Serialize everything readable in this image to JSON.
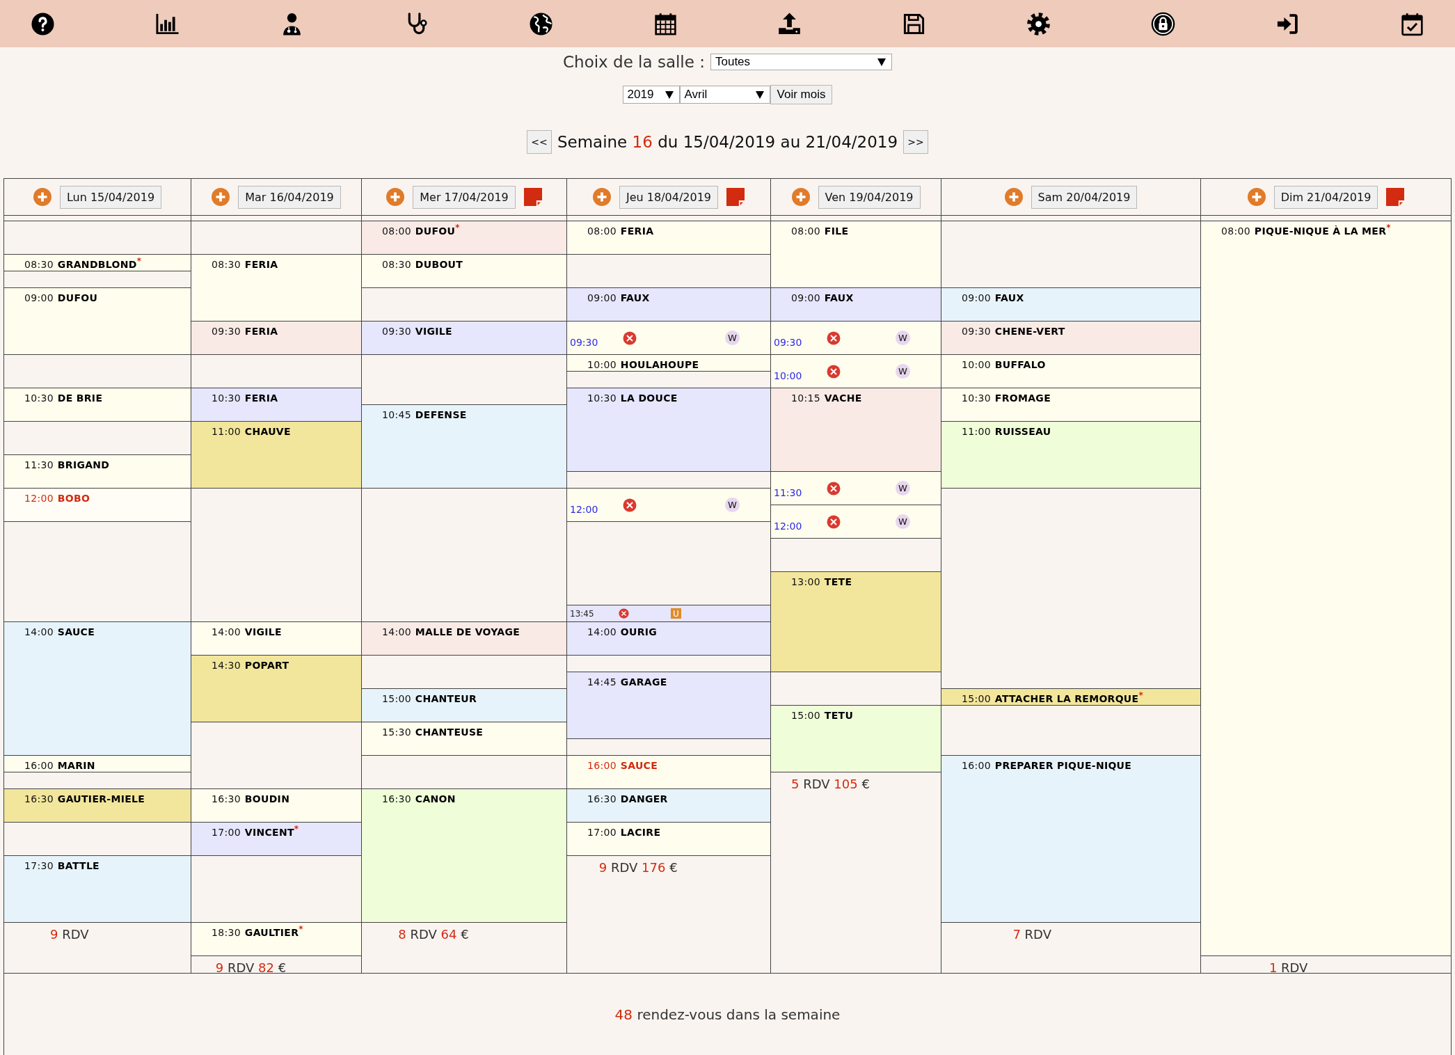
{
  "toolbar": [
    {
      "kind": "help"
    },
    {
      "kind": "chart"
    },
    {
      "kind": "doctor"
    },
    {
      "kind": "stethoscope"
    },
    {
      "kind": "globe"
    },
    {
      "kind": "calendar"
    },
    {
      "kind": "upload"
    },
    {
      "kind": "save"
    },
    {
      "kind": "settings"
    },
    {
      "kind": "lock"
    },
    {
      "kind": "logout"
    },
    {
      "kind": "calendar_check"
    }
  ],
  "room_choice": {
    "label": "Choix de la salle :",
    "value": "Toutes"
  },
  "month_picker": {
    "year": "2019",
    "month": "Avril",
    "button": "Voir mois"
  },
  "week_nav": {
    "prev": "<<",
    "prefix": "Semaine",
    "week": "16",
    "range": "du 15/04/2019 au 21/04/2019",
    "next": ">>"
  },
  "days": [
    {
      "label": "Lun 15/04/2019",
      "has_note": false,
      "items": [
        {
          "kind": "appointment",
          "time": "08:30",
          "name": "GRANDBLOND$^{*}$",
          "color": "#fffdee",
          "alert": false
        },
        {
          "kind": "appointment",
          "time": "09:00",
          "name": "DUFOU",
          "color": "#fffdee",
          "alert": false
        },
        {
          "kind": "appointment",
          "time": "10:30",
          "name": "DE BRIE",
          "color": "#fffdee",
          "alert": false
        },
        {
          "kind": "appointment",
          "time": "11:30",
          "name": "BRIGAND",
          "color": "#fffdee",
          "alert": false
        },
        {
          "kind": "appointment",
          "time": "12:00",
          "name": "BOBO",
          "color": "#fffdf6",
          "alert": true
        },
        {
          "kind": "appointment",
          "time": "14:00",
          "name": "SAUCE",
          "color": "#e7f3fb",
          "alert": false
        },
        {
          "kind": "appointment",
          "time": "16:00",
          "name": "MARIN",
          "color": "#fffdee",
          "alert": false
        },
        {
          "kind": "appointment",
          "time": "16:30",
          "name": "GAUTIER-MIELE",
          "color": "#f2e69c",
          "alert": false
        },
        {
          "kind": "appointment",
          "time": "17:30",
          "name": "BATTLE",
          "color": "#e7f3fb",
          "alert": false
        }
      ],
      "summary": {
        "count": "9",
        "label": "RDV"
      }
    },
    {
      "label": "Mar 16/04/2019",
      "has_note": false,
      "items": [
        {
          "kind": "appointment",
          "time": "08:30",
          "name": "FERIA",
          "color": "#fffdee",
          "alert": false
        },
        {
          "kind": "appointment",
          "time": "09:30",
          "name": "FERIA",
          "color": "#f9eae5",
          "alert": false
        },
        {
          "kind": "appointment",
          "time": "10:30",
          "name": "FERIA",
          "color": "#e6e6fc",
          "alert": false
        },
        {
          "kind": "appointment",
          "time": "11:00",
          "name": "CHAUVE",
          "color": "#f2e69c",
          "alert": false
        },
        {
          "kind": "appointment",
          "time": "14:00",
          "name": "VIGILE",
          "color": "#fffdee",
          "alert": false
        },
        {
          "kind": "appointment",
          "time": "14:30",
          "name": "POPART",
          "color": "#f2e69c",
          "alert": false
        },
        {
          "kind": "appointment",
          "time": "16:30",
          "name": "BOUDIN",
          "color": "#fffdee",
          "alert": false
        },
        {
          "kind": "appointment",
          "time": "17:00",
          "name": "VINCENT$^{*}$",
          "color": "#e6e6fc",
          "alert": false
        },
        {
          "kind": "appointment",
          "time": "18:30",
          "name": "GAULTIER$^{*}$",
          "color": "#fffdee",
          "alert": false
        }
      ],
      "summary": {
        "count": "9",
        "label": "RDV",
        "amount": "82",
        "currency": "€"
      }
    },
    {
      "label": "Mer 17/04/2019",
      "has_note": true,
      "items": [
        {
          "kind": "appointment",
          "time": "08:00",
          "name": "DUFOU$^{*}$",
          "color": "#f9eae5",
          "alert": false
        },
        {
          "kind": "appointment",
          "time": "08:30",
          "name": "DUBOUT",
          "color": "#fffdee",
          "alert": false
        },
        {
          "kind": "appointment",
          "time": "09:30",
          "name": "VIGILE",
          "color": "#e6e6fc",
          "alert": false
        },
        {
          "kind": "appointment",
          "time": "10:45",
          "name": "DEFENSE",
          "color": "#e7f3fb",
          "alert": false
        },
        {
          "kind": "appointment",
          "time": "14:00",
          "name": "MALLE DE VOYAGE",
          "color": "#f9eae5",
          "alert": false
        },
        {
          "kind": "appointment",
          "time": "15:00",
          "name": "CHANTEUR",
          "color": "#e7f3fb",
          "alert": false
        },
        {
          "kind": "appointment",
          "time": "15:30",
          "name": "CHANTEUSE",
          "color": "#fffdee",
          "alert": false
        },
        {
          "kind": "appointment",
          "time": "16:30",
          "name": "CANON",
          "color": "#effed8",
          "alert": false
        }
      ],
      "summary": {
        "count": "8",
        "label": "RDV",
        "amount": "64",
        "currency": "€"
      }
    },
    {
      "label": "Jeu 18/04/2019",
      "has_note": true,
      "items": [
        {
          "kind": "appointment",
          "time": "08:00",
          "name": "FERIA",
          "color": "#fffdee",
          "alert": false
        },
        {
          "kind": "appointment",
          "time": "09:00",
          "name": "FAUX",
          "color": "#e6e6fc",
          "alert": false
        },
        {
          "kind": "slot",
          "time": "09:30",
          "badge": "W",
          "color": "#fffdee"
        },
        {
          "kind": "appointment",
          "time": "10:00",
          "name": "HOULAHOUPE",
          "color": "#fffdee",
          "alert": false
        },
        {
          "kind": "appointment",
          "time": "10:30",
          "name": "LA DOUCE",
          "color": "#e6e6fc",
          "alert": false
        },
        {
          "kind": "slot",
          "time": "12:00",
          "badge": "W",
          "color": "#fffdee"
        },
        {
          "kind": "short_slot",
          "time": "13:45",
          "badge": "U",
          "color": "#e6e6fc"
        },
        {
          "kind": "appointment",
          "time": "14:00",
          "name": "OURIG",
          "color": "#e6e6fc",
          "alert": false
        },
        {
          "kind": "appointment",
          "time": "14:45",
          "name": "GARAGE",
          "color": "#e6e6fc",
          "alert": false
        },
        {
          "kind": "appointment",
          "time": "16:00",
          "name": "SAUCE",
          "color": "#fffdee",
          "alert": true
        },
        {
          "kind": "appointment",
          "time": "16:30",
          "name": "DANGER",
          "color": "#e7f3fb",
          "alert": false
        },
        {
          "kind": "appointment",
          "time": "17:00",
          "name": "LACIRE",
          "color": "#fffdee",
          "alert": false
        }
      ],
      "summary": {
        "count": "9",
        "label": "RDV",
        "amount": "176",
        "currency": "€"
      }
    },
    {
      "label": "Ven 19/04/2019",
      "has_note": false,
      "items": [
        {
          "kind": "appointment",
          "time": "08:00",
          "name": "FILE",
          "color": "#fffdee",
          "alert": false
        },
        {
          "kind": "appointment",
          "time": "09:00",
          "name": "FAUX",
          "color": "#e6e6fc",
          "alert": false
        },
        {
          "kind": "slot",
          "time": "09:30",
          "badge": "W",
          "color": "#fffdee"
        },
        {
          "kind": "slot",
          "time": "10:00",
          "badge": "W",
          "color": "#fffdee"
        },
        {
          "kind": "appointment",
          "time": "10:15",
          "name": "VACHE",
          "color": "#f9eae5",
          "alert": false
        },
        {
          "kind": "slot",
          "time": "11:30",
          "badge": "W",
          "color": "#fffdee"
        },
        {
          "kind": "slot",
          "time": "12:00",
          "badge": "W",
          "color": "#fffdee"
        },
        {
          "kind": "appointment",
          "time": "13:00",
          "name": "TETE",
          "color": "#f2e69c",
          "alert": false
        },
        {
          "kind": "appointment",
          "time": "15:00",
          "name": "TETU",
          "color": "#effed8",
          "alert": false
        }
      ],
      "summary": {
        "count": "5",
        "label": "RDV",
        "amount": "105",
        "currency": "€"
      }
    },
    {
      "label": "Sam 20/04/2019",
      "has_note": false,
      "items": [
        {
          "kind": "appointment",
          "time": "09:00",
          "name": "FAUX",
          "color": "#e7f3fb",
          "alert": false
        },
        {
          "kind": "appointment",
          "time": "09:30",
          "name": "CHENE-VERT",
          "color": "#f9eae5",
          "alert": false
        },
        {
          "kind": "appointment",
          "time": "10:00",
          "name": "BUFFALO",
          "color": "#fffdee",
          "alert": false
        },
        {
          "kind": "appointment",
          "time": "10:30",
          "name": "FROMAGE",
          "color": "#fffdee",
          "alert": false
        },
        {
          "kind": "appointment",
          "time": "11:00",
          "name": "RUISSEAU",
          "color": "#effed8",
          "alert": false
        },
        {
          "kind": "appointment",
          "time": "15:00",
          "name": "ATTACHER LA REMORQUE$^{*}$",
          "color": "#f2e69c",
          "alert": false
        },
        {
          "kind": "appointment",
          "time": "16:00",
          "name": "PREPARER PIQUE-NIQUE",
          "color": "#e7f3fb",
          "alert": false
        }
      ],
      "summary": {
        "count": "7",
        "label": "RDV"
      }
    },
    {
      "label": "Dim 21/04/2019",
      "has_note": true,
      "items": [
        {
          "kind": "appointment",
          "time": "08:00",
          "name": "PIQUE-NIQUE À LA MER$^{*}$",
          "color": "#fffdee",
          "alert": false
        }
      ],
      "summary": {
        "count": "1",
        "label": "RDV"
      }
    }
  ],
  "week_total": {
    "count": "48",
    "text": "rendez-vous dans la semaine"
  }
}
